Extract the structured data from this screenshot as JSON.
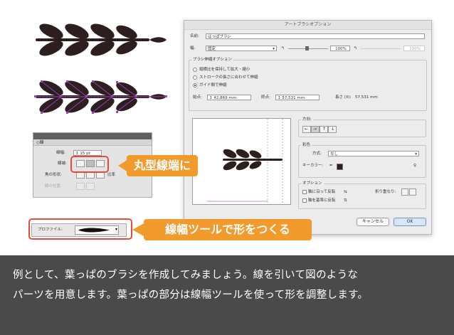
{
  "dialog": {
    "title": "アートブラシオプション",
    "name_label": "名前:",
    "name_value": "はっぱブラシ",
    "width_label": "幅:",
    "width_mode": "固定",
    "width_percent": "100%",
    "width_percent_max": "100%",
    "scale_group_title": "ブラシ伸縮オプション",
    "scale_options": [
      {
        "label": "縦横比を保持して拡大・縮小",
        "selected": false
      },
      {
        "label": "ストロークの長さに合わせて伸縮",
        "selected": false
      },
      {
        "label": "ガイド間で伸縮",
        "selected": true
      }
    ],
    "start_label": "始点:",
    "start_value": "42.869 mm",
    "end_label": "終点:",
    "end_value": "57.531 mm",
    "length_label": "長さ (X):",
    "length_value": "57.531 mm",
    "direction_title": "方向:",
    "direction_arrows": [
      "←",
      "→",
      "↑",
      "↓"
    ],
    "color_title": "彩色",
    "method_label": "方式:",
    "method_value": "なし",
    "key_color_label": "キーカラー:",
    "options_title": "オプション",
    "flip_along_label": "軸に沿って反転",
    "flip_across_label": "軸を基準に反転",
    "overlap_label": "折り重なり:",
    "cancel_label": "キャンセル",
    "ok_label": "OK"
  },
  "stroke_panel": {
    "tab_label": "◇線",
    "weight_label": "線幅:",
    "weight_value": "15 pt",
    "cap_label": "線端:",
    "corner_label": "角の形状:",
    "align_label": "線の位置:",
    "ratio_label": "比率",
    "profile_label": "プロファイル:"
  },
  "callouts": {
    "round_cap": "丸型線端に",
    "width_tool": "線幅ツールで形をつくる"
  },
  "caption": {
    "line1": "例として、葉っぱのブラシを作成してみましょう。線を引いて図のような",
    "line2": "パーツを用意します。葉っぱの部分は線幅ツールを使って形を調整します。"
  },
  "colors": {
    "accent_orange": "#f39a2d",
    "highlight_red": "#e94a37",
    "leaf_dark": "#2d1f1f",
    "path_purple": "#a040c0",
    "caption_bg": "#4a4a4a"
  }
}
